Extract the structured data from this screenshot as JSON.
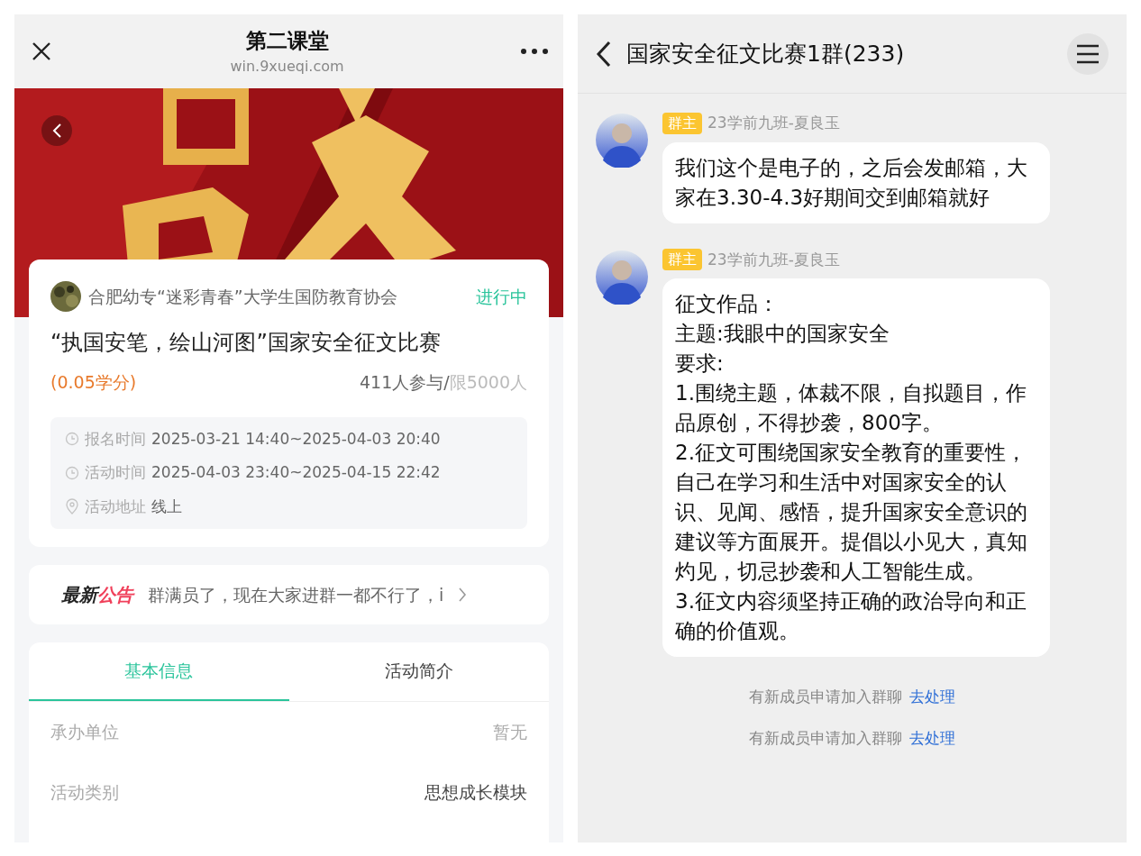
{
  "left": {
    "header": {
      "title": "第二课堂",
      "subtitle": "win.9xueqi.com"
    },
    "activity": {
      "organizer": "合肥幼专“迷彩青春”大学生国防教育协会",
      "status": "进行中",
      "title": "“执国安笔，绘山河图”国家安全征文比赛",
      "credit": "(0.05学分)",
      "participants": "411人参与/",
      "limit": "限5000人",
      "details": [
        {
          "kind": "clock",
          "label": "报名时间",
          "value": "2025-03-21 14:40~2025-04-03 20:40"
        },
        {
          "kind": "clock",
          "label": "活动时间",
          "value": "2025-04-03 23:40~2025-04-15 22:42"
        },
        {
          "kind": "location",
          "label": "活动地址",
          "value": "线上"
        }
      ]
    },
    "notice": {
      "label_dark": "最新",
      "label_accent": "公告",
      "text": "群满员了，现在大家进群一都不行了，i"
    },
    "tabs": [
      {
        "label": "基本信息",
        "selected": true
      },
      {
        "label": "活动简介",
        "selected": false
      }
    ],
    "info_rows": [
      {
        "label": "承办单位",
        "value": "暂无",
        "muted": true
      },
      {
        "label": "活动类别",
        "value": "思想成长模块",
        "muted": false
      }
    ]
  },
  "right": {
    "header": {
      "title": "国家安全征文比赛1群(233)"
    },
    "messages": [
      {
        "badge": "群主",
        "sender": "23学前九班-夏良玉",
        "paragraphs": [
          "我们这个是电子的，之后会发邮箱，大家在3.30-4.3好期间交到邮箱就好"
        ]
      },
      {
        "badge": "群主",
        "sender": "23学前九班-夏良玉",
        "paragraphs": [
          "征文作品：",
          "主题:我眼中的国家安全",
          "要求:",
          "1.围绕主题，体裁不限，自拟题目，作品原创，不得抄袭，800字。",
          "2.征文可围绕国家安全教育的重要性，自己在学习和生活中对国家安全的认识、见闻、感悟，提升国家安全意识的建议等方面展开。提倡以小见大，真知灼见，切忌抄袭和人工智能生成。",
          "3.征文内容须坚持正确的政治导向和正确的价值观。"
        ]
      }
    ],
    "system_notices": [
      {
        "text": "有新成员申请加入群聊",
        "link": "去处理"
      },
      {
        "text": "有新成员申请加入群聊",
        "link": "去处理"
      }
    ]
  }
}
